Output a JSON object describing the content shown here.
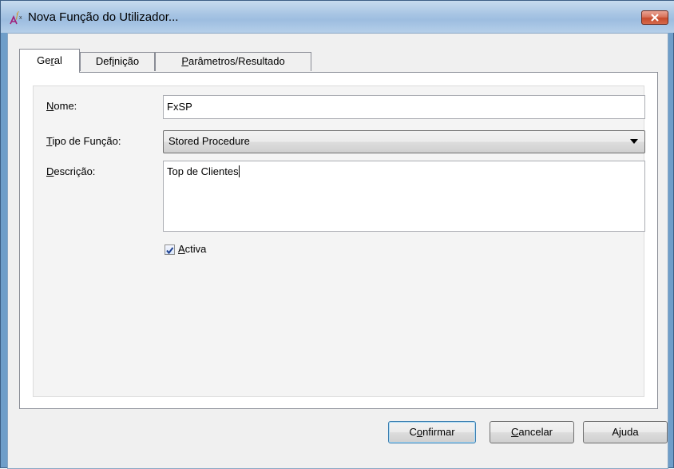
{
  "window": {
    "title": "Nova Função do Utilizador...",
    "icon": "function-fx-icon",
    "accent_color": "#6f9ec9"
  },
  "tabs": [
    {
      "mnemonic_before": "Ge",
      "mnemonic": "r",
      "mnemonic_after": "al",
      "label": "Geral",
      "active": true
    },
    {
      "mnemonic_before": "Def",
      "mnemonic": "i",
      "mnemonic_after": "nição",
      "label": "Definição",
      "active": false
    },
    {
      "mnemonic_before": "",
      "mnemonic": "P",
      "mnemonic_after": "arâmetros/Resultado",
      "label": "Parâmetros/Resultado",
      "active": false
    }
  ],
  "form": {
    "nome": {
      "mnemonic": "N",
      "rest": "ome:",
      "value": "FxSP"
    },
    "tipo": {
      "mnemonic": "T",
      "rest": "ipo de Função:",
      "value": "Stored Procedure"
    },
    "descricao": {
      "mnemonic": "D",
      "rest": "escrição:",
      "value": "Top de Clientes"
    },
    "activa": {
      "mnemonic": "A",
      "rest": "ctiva",
      "checked": true
    }
  },
  "buttons": {
    "confirmar": {
      "before": "C",
      "mnemonic": "o",
      "after": "nfirmar"
    },
    "cancelar": {
      "before": "",
      "mnemonic": "C",
      "after": "ancelar"
    },
    "ajuda": {
      "before": "A",
      "mnemonic": "j",
      "after": "uda"
    }
  }
}
